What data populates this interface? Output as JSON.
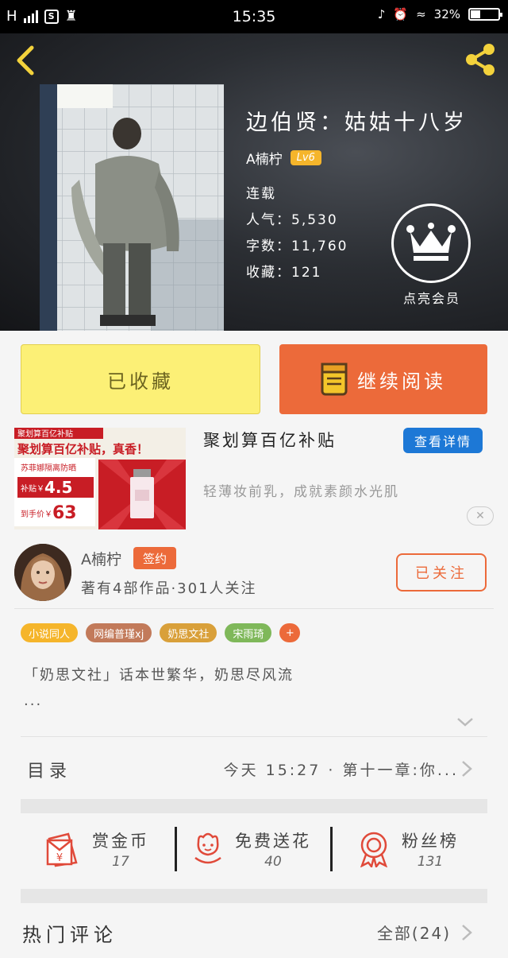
{
  "status_bar": {
    "network": "H",
    "time": "15:35",
    "battery": "32%",
    "battery_level": 0.32
  },
  "header": {
    "book_title": "边伯贤：姑姑十八岁",
    "author": "A楠柠",
    "level_badge": "Lv6",
    "status": "连载",
    "popularity": "人气：5,530",
    "word_count": "字数：11,760",
    "favorites": "收藏：121",
    "vip_label": "点亮会员"
  },
  "actions": {
    "collected_label": "已收藏",
    "continue_label": "继续阅读"
  },
  "ad": {
    "image_title": "聚划算百亿补贴",
    "image_headline": "聚划算百亿补贴，真香！",
    "image_product": "苏菲娜隔离防晒",
    "image_subsidy_label": "补贴￥",
    "image_subsidy_value": "4.5",
    "image_price_label": "到手价￥",
    "image_price_value": "63",
    "title": "聚划算百亿补贴",
    "detail_button": "查看详情",
    "description": "轻薄妆前乳，成就素颜水光肌",
    "close": "✕"
  },
  "author_info": {
    "name": "A楠柠",
    "sign_badge": "签约",
    "meta": "著有4部作品·301人关注",
    "follow_button": "已关注"
  },
  "tags": [
    {
      "label": "小说同人",
      "color": "#f5b52b"
    },
    {
      "label": "网编普瑾xj",
      "color": "#c27a5a"
    },
    {
      "label": "奶思文社",
      "color": "#d9a03a"
    },
    {
      "label": "宋雨琦",
      "color": "#7fb85a"
    },
    {
      "label": "+",
      "color": "#ec6a3a"
    }
  ],
  "description": {
    "line1": "「奶思文社」话本世繁华，奶思尽风流",
    "line2": "..."
  },
  "catalog": {
    "label": "目录",
    "latest": "今天 15:27 · 第十一章:你..."
  },
  "rewards": [
    {
      "label": "赏金币",
      "value": "17",
      "icon": "red-envelope-icon"
    },
    {
      "label": "免费送花",
      "value": "40",
      "icon": "flower-icon"
    },
    {
      "label": "粉丝榜",
      "value": "131",
      "icon": "medal-icon"
    }
  ],
  "hot_comments": {
    "label": "热门评论",
    "all": "全部(24)"
  },
  "colors": {
    "accent": "#ec6a3a",
    "collected_bg": "#fcf076",
    "detail_blue": "#1d78d6",
    "gold": "#f5b52b"
  }
}
